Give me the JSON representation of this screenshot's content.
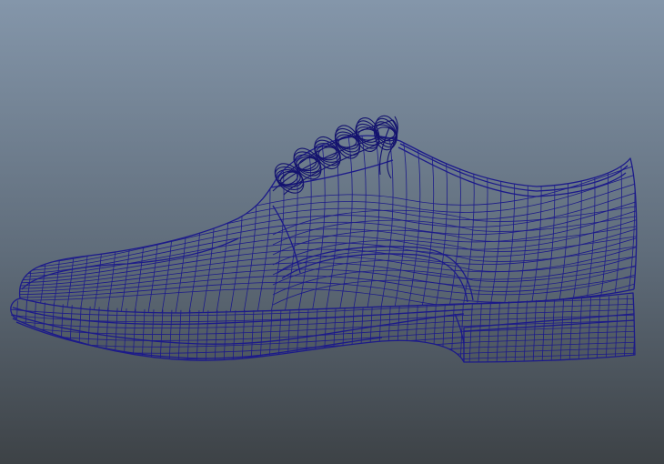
{
  "viewport": {
    "background_top": "#8496aa",
    "background_mid": "#5f6c7a",
    "background_bottom": "#3d4246",
    "wire_color": "#1c1a8a",
    "wire_dense_color": "#14136e"
  },
  "model": {
    "display_mode": "wireframe"
  }
}
